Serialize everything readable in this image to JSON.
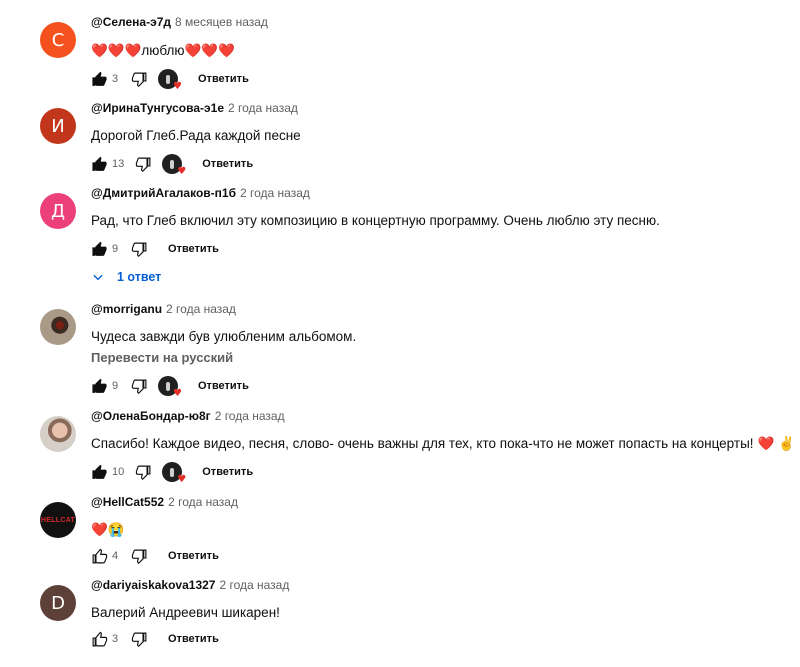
{
  "comments": [
    {
      "avatar_letter": "С",
      "avatar_color": "#f4511e",
      "author": "@Селена-э7д",
      "time": "8 месяцев назад",
      "text": "❤️❤️❤️люблю❤️❤️❤️",
      "likes": "3",
      "hearted": true,
      "reply_label": "Ответить"
    },
    {
      "avatar_letter": "И",
      "avatar_color": "#c2371b",
      "author": "@ИринаТунгусова-э1е",
      "time": "2 года назад",
      "text": "Дорогой Глеб.Рада каждой песне",
      "likes": "13",
      "hearted": true,
      "reply_label": "Ответить"
    },
    {
      "avatar_letter": "Д",
      "avatar_color": "#ec407a",
      "author": "@ДмитрийАгалаков-п1б",
      "time": "2 года назад",
      "text": "Рад, что Глеб включил эту композицию в концертную программу. Очень люблю эту песню.",
      "likes": "9",
      "hearted": false,
      "reply_label": "Ответить",
      "replies_label": "1 ответ"
    },
    {
      "avatar_letter": "",
      "avatar_color": "#a89a86",
      "author": "@morriganu",
      "time": "2 года назад",
      "text": "Чудеса завжди був улюбленим альбомом.",
      "translate_label": "Перевести на русский",
      "likes": "9",
      "hearted": true,
      "reply_label": "Ответить"
    },
    {
      "avatar_letter": "",
      "avatar_color": "#d6cfc8",
      "author": "@ОленаБондар-ю8г",
      "time": "2 года назад",
      "text": "Спасибо! Каждое видео, песня, слово- очень важны для тех, кто пока-что не может попасть на концерты!",
      "text_emoji": "❤️ ✌️",
      "likes": "10",
      "hearted": true,
      "reply_label": "Ответить"
    },
    {
      "avatar_letter": "HELLCAT",
      "avatar_color": "#111111",
      "author": "@HellCat552",
      "time": "2 года назад",
      "text": "❤️😭",
      "likes": "4",
      "hearted": false,
      "reply_label": "Ответить"
    },
    {
      "avatar_letter": "D",
      "avatar_color": "#5d4037",
      "author": "@dariyaiskakova1327",
      "time": "2 года назад",
      "text": "Валерий Андреевич шикарен!",
      "likes": "3",
      "hearted": false,
      "reply_label": "Ответить"
    }
  ]
}
